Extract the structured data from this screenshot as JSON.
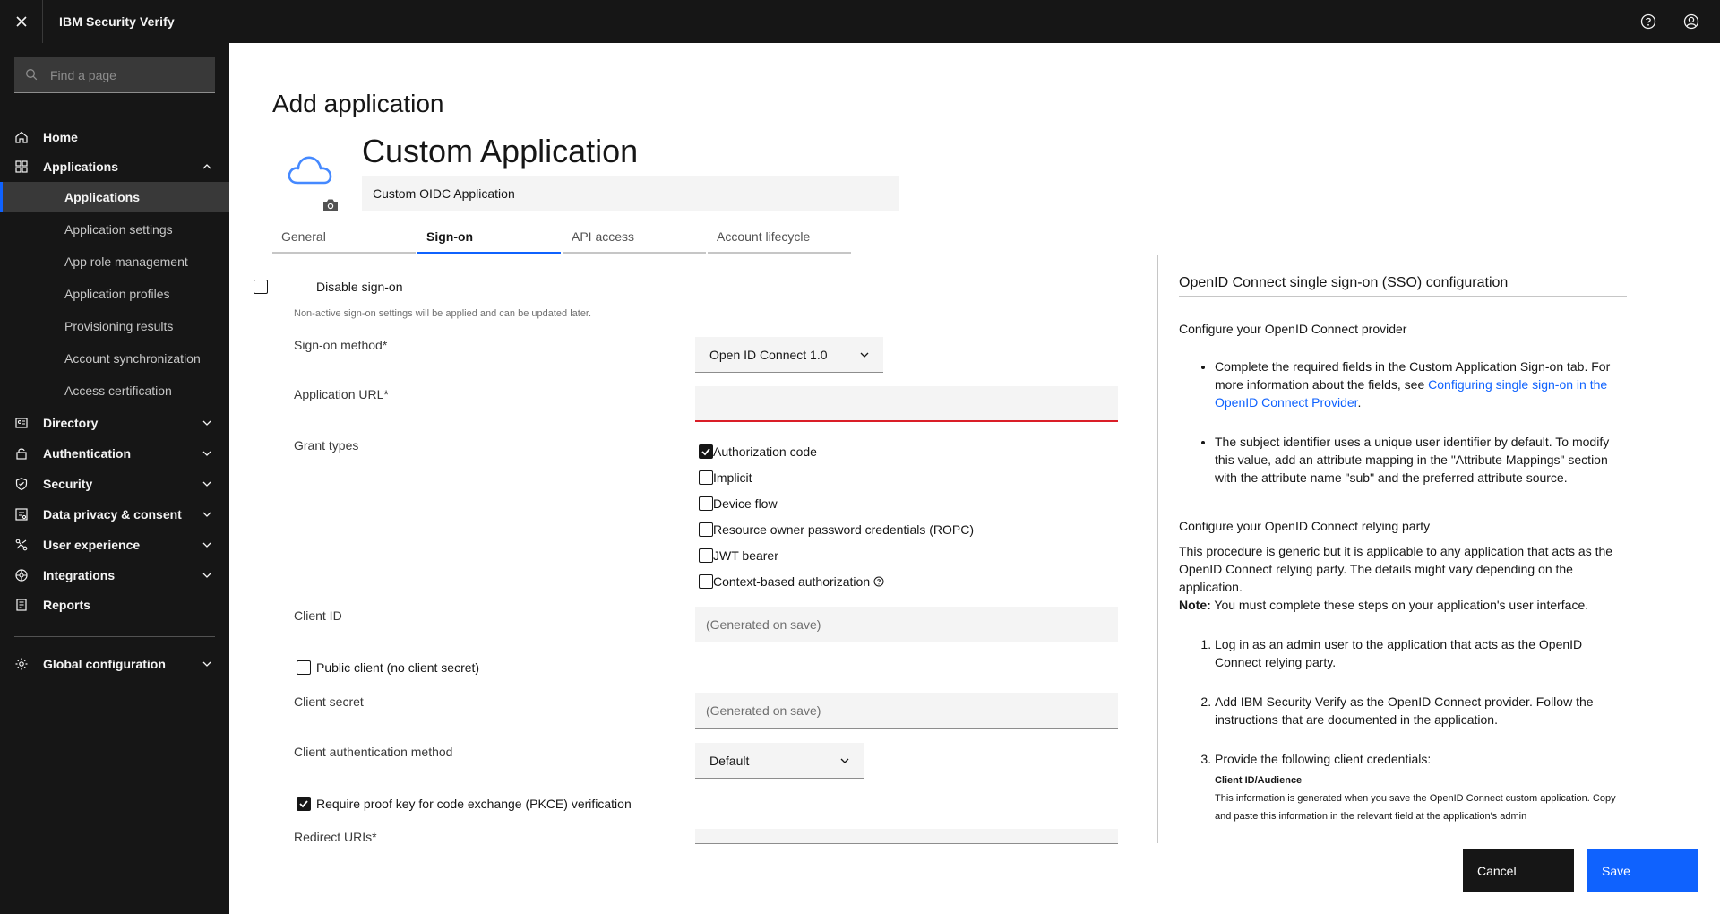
{
  "header": {
    "product": "IBM Security Verify",
    "close_icon": "close-icon",
    "help_icon": "help-icon",
    "user_icon": "user-avatar-icon"
  },
  "sidebar": {
    "search_placeholder": "Find a page",
    "items": [
      {
        "label": "Home",
        "icon": "home-icon"
      },
      {
        "label": "Applications",
        "icon": "applications-icon",
        "expanded": true,
        "children": [
          "Applications",
          "Application settings",
          "App role management",
          "Application profiles",
          "Provisioning results",
          "Account synchronization",
          "Access certification"
        ],
        "active_child": "Applications"
      },
      {
        "label": "Directory",
        "icon": "directory-icon"
      },
      {
        "label": "Authentication",
        "icon": "lock-icon"
      },
      {
        "label": "Security",
        "icon": "shield-icon"
      },
      {
        "label": "Data privacy & consent",
        "icon": "data-privacy-icon"
      },
      {
        "label": "User experience",
        "icon": "user-experience-icon"
      },
      {
        "label": "Integrations",
        "icon": "integrations-icon"
      },
      {
        "label": "Reports",
        "icon": "reports-icon"
      },
      {
        "label": "Global configuration",
        "icon": "gear-icon"
      }
    ]
  },
  "page": {
    "title": "Add application",
    "app_name": "Custom Application",
    "app_description": "Custom OIDC Application",
    "tabs": [
      {
        "label": "General",
        "active": false
      },
      {
        "label": "Sign-on",
        "active": true
      },
      {
        "label": "API access",
        "active": false
      },
      {
        "label": "Account lifecycle",
        "active": false
      }
    ]
  },
  "form": {
    "disable_signon": {
      "label": "Disable sign-on",
      "checked": false
    },
    "disable_helper": "Non-active sign-on settings will be applied and can be updated later.",
    "signon_method": {
      "label": "Sign-on method*",
      "value": "Open ID Connect 1.0"
    },
    "app_url": {
      "label": "Application URL*",
      "value": ""
    },
    "grant_types": {
      "label": "Grant types",
      "options": [
        {
          "label": "Authorization code",
          "checked": true
        },
        {
          "label": "Implicit",
          "checked": false
        },
        {
          "label": "Device flow",
          "checked": false
        },
        {
          "label": "Resource owner password credentials (ROPC)",
          "checked": false
        },
        {
          "label": "JWT bearer",
          "checked": false
        },
        {
          "label": "Context-based authorization",
          "checked": false
        }
      ]
    },
    "client_id": {
      "label": "Client ID",
      "placeholder": "(Generated on save)"
    },
    "public_client": {
      "label": "Public client (no client secret)",
      "checked": false
    },
    "client_secret": {
      "label": "Client secret",
      "placeholder": "(Generated on save)"
    },
    "client_auth_method": {
      "label": "Client authentication method",
      "value": "Default"
    },
    "pkce": {
      "label": "Require proof key for code exchange (PKCE) verification",
      "checked": true
    },
    "redirect_uris": {
      "label": "Redirect URIs*"
    }
  },
  "help": {
    "heading": "OpenID Connect single sign-on (SSO) configuration",
    "provider_heading": "Configure your OpenID Connect provider",
    "bullet1_text": "Complete the required fields in the Custom Application Sign-on tab. For more information about the fields, see ",
    "bullet1_link": "Configuring single sign-on in the OpenID Connect Provider",
    "bullet1_end": ".",
    "bullet2": "The subject identifier uses a unique user identifier by default. To modify this value, add an attribute mapping in the \"Attribute Mappings\" section with the attribute name \"sub\" and the preferred attribute source.",
    "rp_heading": "Configure your OpenID Connect relying party",
    "rp_intro": "This procedure is generic but it is applicable to any application that acts as the OpenID Connect relying party. The details might vary depending on the application.",
    "note_label": "Note:",
    "note_text": " You must complete these steps on your application's user interface.",
    "steps": [
      "Log in as an admin user to the application that acts as the OpenID Connect relying party.",
      "Add IBM Security Verify as the OpenID Connect provider. Follow the instructions that are documented in the application.",
      "Provide the following client credentials:"
    ],
    "cred_title": "Client ID/Audience",
    "cred_text": "This information is generated when you save the OpenID Connect custom application. Copy and paste this information in the relevant field at the application's admin"
  },
  "footer": {
    "cancel": "Cancel",
    "save": "Save"
  },
  "colors": {
    "accent": "#0f62fe",
    "shell": "#161616",
    "error": "#da1e28"
  }
}
